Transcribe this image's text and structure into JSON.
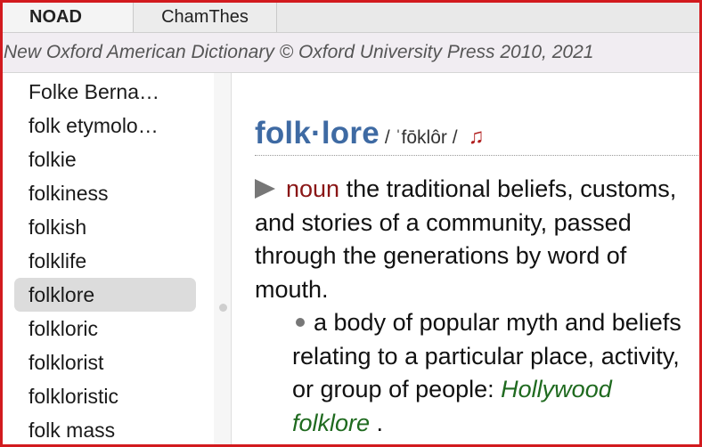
{
  "tabs": [
    {
      "label": "NOAD",
      "active": true
    },
    {
      "label": "ChamThes",
      "active": false
    }
  ],
  "banner": "New Oxford American Dictionary © Oxford University Press 2010, 2021",
  "sidebar": {
    "items": [
      {
        "label": "Folke Berna…"
      },
      {
        "label": "folk etymolo…"
      },
      {
        "label": "folkie"
      },
      {
        "label": "folkiness"
      },
      {
        "label": "folkish"
      },
      {
        "label": "folklife"
      },
      {
        "label": "folklore",
        "selected": true
      },
      {
        "label": "folkloric"
      },
      {
        "label": "folklorist"
      },
      {
        "label": "folkloristic"
      },
      {
        "label": "folk mass"
      }
    ]
  },
  "entry": {
    "headword": "folk·lore",
    "pronunciation": "/ ˈfōklôr /",
    "audio_icon": "♫",
    "sense": {
      "pos": "noun",
      "definition": " the traditional beliefs, customs, and stories of a community, passed through the generations by word of mouth.",
      "subsense": {
        "definition": "a body of popular myth and beliefs relating to a particular place, activity, or group of people: ",
        "example": "Hollywood folklore",
        "end": " ."
      }
    }
  },
  "colors": {
    "frame": "#d21a1e",
    "headword": "#3e6aa3",
    "pos": "#8a1616",
    "example": "#1f6a1f"
  }
}
